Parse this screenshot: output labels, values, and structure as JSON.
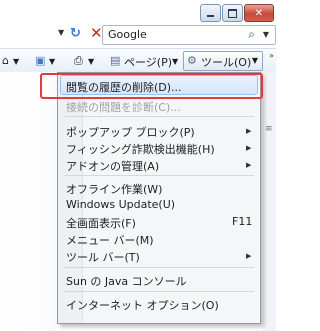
{
  "address_bar": {
    "search_text": "Google"
  },
  "command_bar": {
    "page_label": "ページ(P)",
    "tools_label": "ツール(O)"
  },
  "menu": {
    "items": [
      {
        "label": "閲覧の履歴の削除(D)...",
        "state": "highlighted"
      },
      {
        "label": "接続の問題を診断(C)...",
        "state": "disabled"
      },
      {
        "label": "ポップアップ ブロック(P)",
        "submenu": true
      },
      {
        "label": "フィッシング詐欺検出機能(H)",
        "submenu": true
      },
      {
        "label": "アドオンの管理(A)",
        "submenu": true
      },
      {
        "label": "オフライン作業(W)"
      },
      {
        "label": "Windows Update(U)"
      },
      {
        "label": "全画面表示(F)",
        "shortcut": "F11"
      },
      {
        "label": "メニュー バー(M)"
      },
      {
        "label": "ツール バー(T)",
        "submenu": true
      },
      {
        "label": "Sun の Java コンソール"
      },
      {
        "label": "インターネット オプション(O)"
      }
    ]
  },
  "colors": {
    "annotation_red": "#e13b3b",
    "highlight": "#d3e6fb",
    "close_button": "#c7483a"
  }
}
